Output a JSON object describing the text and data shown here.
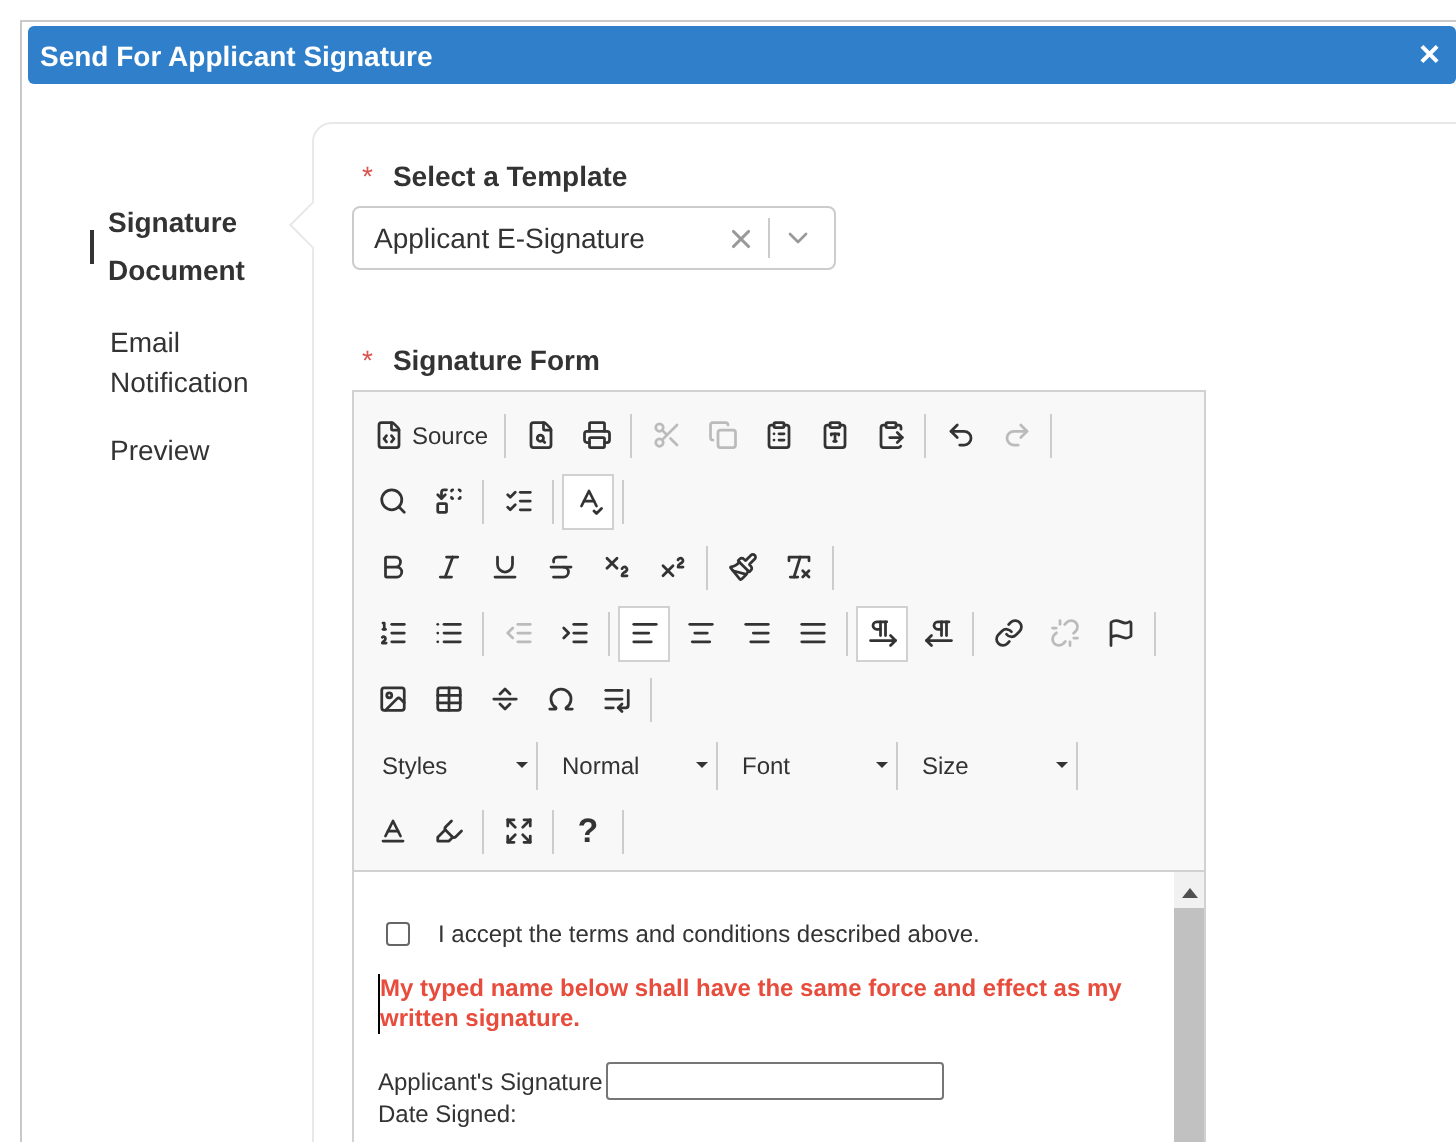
{
  "dialog": {
    "title": "Send For Applicant Signature",
    "close": "×"
  },
  "steps": [
    {
      "label": "Signature Document",
      "selected": true
    },
    {
      "label": "Email Notification",
      "selected": false
    },
    {
      "label": "Preview",
      "selected": false
    }
  ],
  "template": {
    "label": "Select a Template",
    "required_mark": "*",
    "value": "Applicant E-Signature"
  },
  "form": {
    "label": "Signature Form",
    "required_mark": "*",
    "toolbar": [
      [
        [
          {
            "label": "Source",
            "disabled": false,
            "pressed": false
          }
        ],
        [
          {
            "disabled": false,
            "pressed": false
          },
          {
            "disabled": false,
            "pressed": false
          }
        ],
        [
          {
            "disabled": true,
            "pressed": false
          },
          {
            "disabled": true,
            "pressed": false
          },
          {
            "disabled": false,
            "pressed": false
          },
          {
            "disabled": false,
            "pressed": false
          },
          {
            "disabled": false,
            "pressed": false
          }
        ],
        [
          {
            "disabled": false,
            "pressed": false
          },
          {
            "disabled": true,
            "pressed": false
          }
        ]
      ],
      [
        [
          {
            "disabled": false,
            "pressed": false
          },
          {
            "disabled": false,
            "pressed": false
          }
        ],
        [
          {
            "disabled": false,
            "pressed": false
          }
        ],
        [
          {
            "disabled": false,
            "pressed": true
          }
        ]
      ],
      [
        [
          {
            "disabled": false,
            "pressed": false
          },
          {
            "disabled": false,
            "pressed": false
          },
          {
            "disabled": false,
            "pressed": false
          },
          {
            "disabled": false,
            "pressed": false
          },
          {
            "disabled": false,
            "pressed": false
          },
          {
            "disabled": false,
            "pressed": false
          }
        ],
        [
          {
            "disabled": false,
            "pressed": false
          },
          {
            "disabled": false,
            "pressed": false
          }
        ]
      ],
      [
        [
          {
            "disabled": false,
            "pressed": false
          },
          {
            "disabled": false,
            "pressed": false
          }
        ],
        [
          {
            "disabled": true,
            "pressed": false
          },
          {
            "disabled": false,
            "pressed": false
          }
        ],
        [
          {
            "disabled": false,
            "pressed": true
          },
          {
            "disabled": false,
            "pressed": false
          },
          {
            "disabled": false,
            "pressed": false
          },
          {
            "disabled": false,
            "pressed": false
          }
        ],
        [
          {
            "disabled": false,
            "pressed": true
          },
          {
            "disabled": false,
            "pressed": false
          }
        ],
        [
          {
            "disabled": false,
            "pressed": false
          },
          {
            "disabled": true,
            "pressed": false
          },
          {
            "disabled": false,
            "pressed": false
          }
        ]
      ],
      [
        [
          {
            "disabled": false,
            "pressed": false
          },
          {
            "disabled": false,
            "pressed": false
          },
          {
            "disabled": false,
            "pressed": false
          },
          {
            "disabled": false,
            "pressed": false
          },
          {
            "disabled": false,
            "pressed": false
          }
        ]
      ]
    ],
    "combos": [
      "Styles",
      "Normal",
      "Font",
      "Size"
    ],
    "bottom_tools": [
      [
        {
          "disabled": false,
          "pressed": false
        },
        {
          "disabled": false,
          "pressed": false
        }
      ],
      [
        {
          "disabled": false,
          "pressed": false
        }
      ],
      [
        {
          "label": "?",
          "disabled": false,
          "pressed": false
        }
      ]
    ],
    "content": {
      "terms": {
        "label": "I accept the terms and conditions described above.",
        "checked": false
      },
      "notice": "My typed name below shall have the same force and effect as my written signature.",
      "signature_label": "Applicant's Signature",
      "date_label": "Date Signed:"
    }
  }
}
